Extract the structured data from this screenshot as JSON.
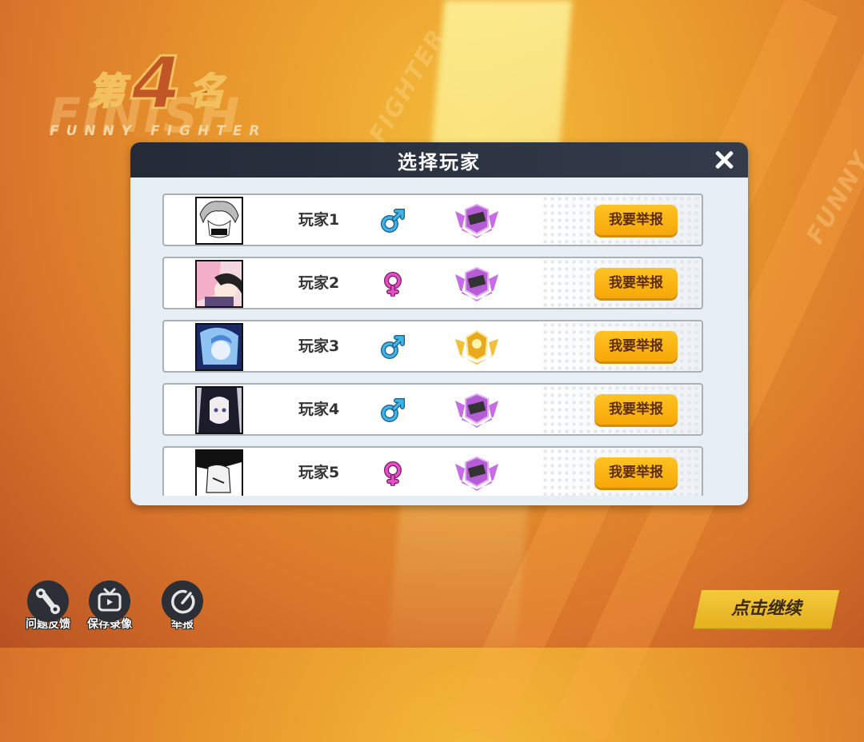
{
  "rank": {
    "prefix": "第",
    "number": "4",
    "suffix": "名",
    "subtitle": "FUNNY FIGHTER"
  },
  "background": {
    "word_finish": "FINISH",
    "word_fighter": "FIGHTER",
    "word_funny": "FUNNY"
  },
  "modal": {
    "title": "选择玩家",
    "players": [
      {
        "name": "玩家1",
        "gender": "male",
        "badge": "purple",
        "report_label": "我要举报"
      },
      {
        "name": "玩家2",
        "gender": "female",
        "badge": "purple",
        "report_label": "我要举报"
      },
      {
        "name": "玩家3",
        "gender": "male",
        "badge": "gold",
        "report_label": "我要举报"
      },
      {
        "name": "玩家4",
        "gender": "male",
        "badge": "purple",
        "report_label": "我要举报"
      },
      {
        "name": "玩家5",
        "gender": "female",
        "badge": "purple",
        "report_label": "我要举报"
      }
    ]
  },
  "toolbar": {
    "feedback_label": "问题反馈",
    "save_replay_label": "保存录像",
    "report_label": "举报"
  },
  "continue_label": "点击继续",
  "colors": {
    "male": "#3db3e8",
    "female": "#e54fc9",
    "button": "#f6a708",
    "header": "#262c38"
  }
}
